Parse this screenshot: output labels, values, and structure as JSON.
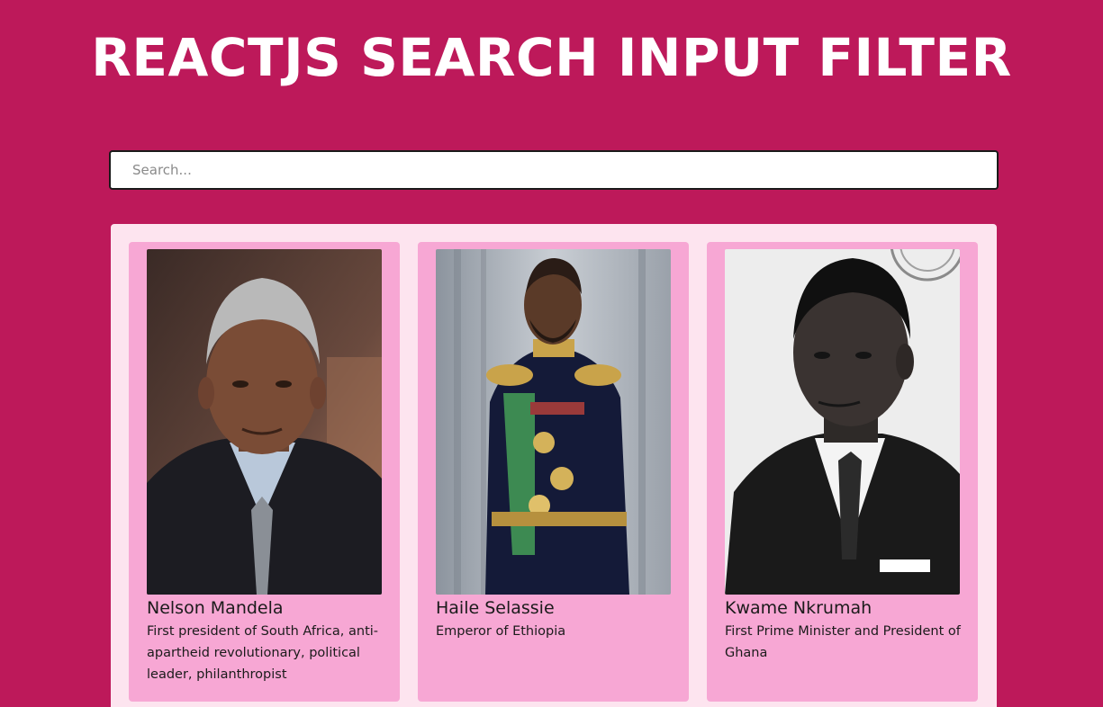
{
  "header": {
    "title": "REACTJS SEARCH INPUT FILTER"
  },
  "search": {
    "placeholder": "Search...",
    "value": ""
  },
  "colors": {
    "background": "#bd195a",
    "panel": "#fde4ef",
    "card": "#f7a7d4"
  },
  "people": [
    {
      "name": "Nelson Mandela",
      "description": "First president of South Africa, anti-apartheid revolutionary, political leader, philanthropist",
      "photo": "portrait-photo"
    },
    {
      "name": "Haile Selassie",
      "description": "Emperor of Ethiopia",
      "photo": "portrait-photo"
    },
    {
      "name": "Kwame Nkrumah",
      "description": "First Prime Minister and President of Ghana",
      "photo": "portrait-photo"
    }
  ]
}
